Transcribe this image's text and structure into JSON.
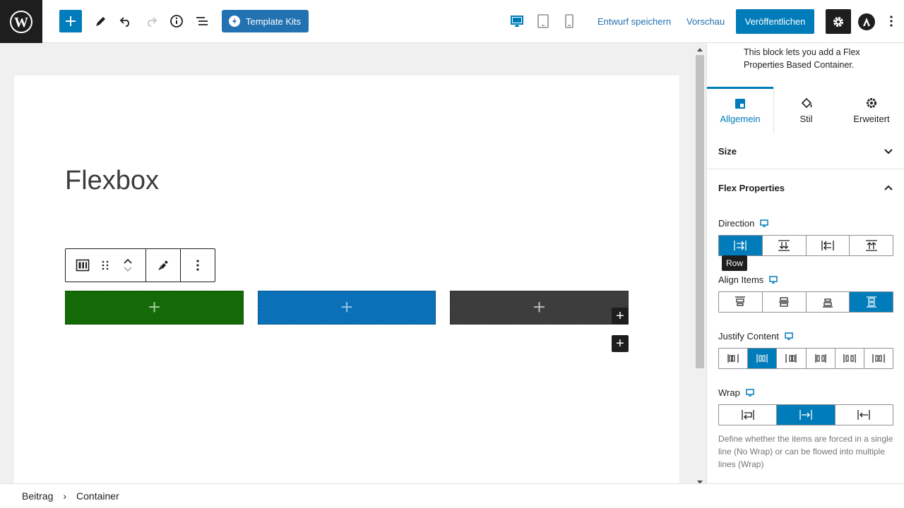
{
  "topbar": {
    "template_kits_label": "Template Kits",
    "save_draft_label": "Entwurf speichern",
    "preview_label": "Vorschau",
    "publish_label": "Veröffentlichen",
    "icons": [
      "wordpress-logo",
      "add-block",
      "edit-tool",
      "undo",
      "redo",
      "details-info",
      "list-view",
      "template-kits",
      "desktop",
      "tablet",
      "mobile",
      "settings",
      "astra",
      "more-options"
    ]
  },
  "editor": {
    "post_title": "Flexbox",
    "columns": [
      {
        "color": "#136a06"
      },
      {
        "color": "#0a70b8"
      },
      {
        "color": "#3d3d3d"
      }
    ],
    "column_plus": "+",
    "appender_plus": "+"
  },
  "sidebar": {
    "description": "This block lets you add a Flex Properties Based Container.",
    "tabs": [
      {
        "label": "Allgemein",
        "active": true
      },
      {
        "label": "Stil",
        "active": false
      },
      {
        "label": "Erweitert",
        "active": false
      }
    ],
    "panels": {
      "size": "Size",
      "flex_properties": "Flex Properties"
    },
    "controls": {
      "direction": {
        "label": "Direction",
        "selected_index": 0,
        "options": 4,
        "tooltip": "Row"
      },
      "align_items": {
        "label": "Align Items",
        "selected_index": 3,
        "options": 4
      },
      "justify_content": {
        "label": "Justify Content",
        "selected_index": 1,
        "options": 6
      },
      "wrap": {
        "label": "Wrap",
        "selected_index": 1,
        "options": 3
      }
    },
    "wrap_help": "Define whether the items are forced in a single line (No Wrap) or can be flowed into multiple lines (Wrap)"
  },
  "breadcrumb": {
    "items": [
      "Beitrag",
      "Container"
    ]
  },
  "colors": {
    "accent": "#007cba",
    "dark": "#1e1e1e"
  }
}
